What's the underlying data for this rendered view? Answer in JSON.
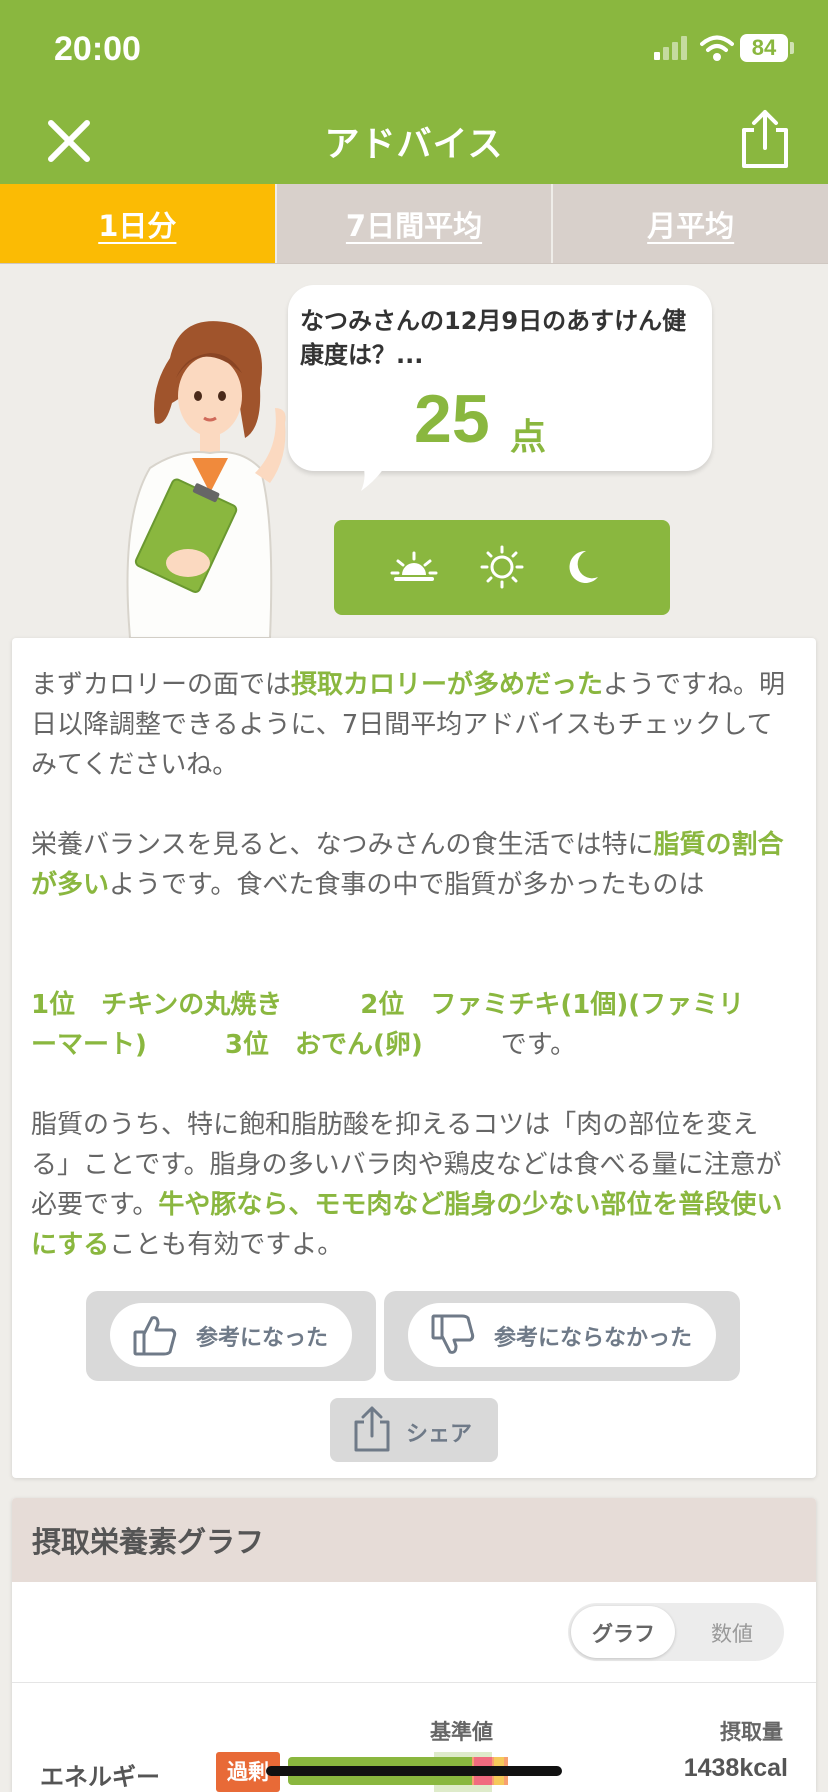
{
  "status": {
    "time": "20:00",
    "battery": "84"
  },
  "header": {
    "title": "アドバイス"
  },
  "tabs": [
    {
      "label": "1日分",
      "active": true
    },
    {
      "label": "7日間平均",
      "active": false
    },
    {
      "label": "月平均",
      "active": false
    }
  ],
  "bubble": {
    "text": "なつみさんの12月9日のあすけん健康度は？...",
    "score": "25",
    "score_unit": "点"
  },
  "meal_icons": [
    "sunrise-icon",
    "sun-icon",
    "moon-icon"
  ],
  "advice": {
    "p1": [
      {
        "t": "まずカロリーの面では",
        "hl": false
      },
      {
        "t": "摂取カロリーが多めだった",
        "hl": true
      },
      {
        "t": "ようですね。明日以降調整できるように、7日間平均アドバイスもチェックしてみてくださいね。",
        "hl": false
      }
    ],
    "p2": [
      {
        "t": "栄養バランスを見ると、なつみさんの食生活では特に",
        "hl": false
      },
      {
        "t": "脂質の割合が多い",
        "hl": true
      },
      {
        "t": "ようです。食べた食事の中で脂質が多かったものは",
        "hl": false
      }
    ],
    "rank_line1": "1位　チキンの丸焼き　　　2位　ファミチキ(1個)(ファミリ",
    "rank_line2_hl": "ーマート)　　　3位　おでん(卵)　　　",
    "rank_line2_tail": "です。",
    "p3": [
      {
        "t": "脂質のうち、特に飽和脂肪酸を抑えるコツは「肉の部位を変える」ことです。脂身の多いバラ肉や鶏皮などは食べる量に注意が必要です。",
        "hl": false
      },
      {
        "t": "牛や豚なら、モモ肉など脂身の少ない部位を普段使いにする",
        "hl": true
      },
      {
        "t": "ことも有効ですよ。",
        "hl": false
      }
    ]
  },
  "feedback": {
    "helpful": "参考になった",
    "not_helpful": "参考にならなかった",
    "share": "シェア"
  },
  "nutrients": {
    "title": "摂取栄養素グラフ",
    "toggle": {
      "graph": "グラフ",
      "value": "数値",
      "selected": "グラフ"
    },
    "col_ref": "基準値",
    "col_amount": "摂取量",
    "rows": [
      {
        "name": "エネルギー",
        "badge": "過剰",
        "amount": "1438kcal"
      }
    ]
  },
  "colors": {
    "brand_green": "#8ab73f",
    "tab_active": "#fbbb04",
    "badge_over": "#e86a37"
  }
}
